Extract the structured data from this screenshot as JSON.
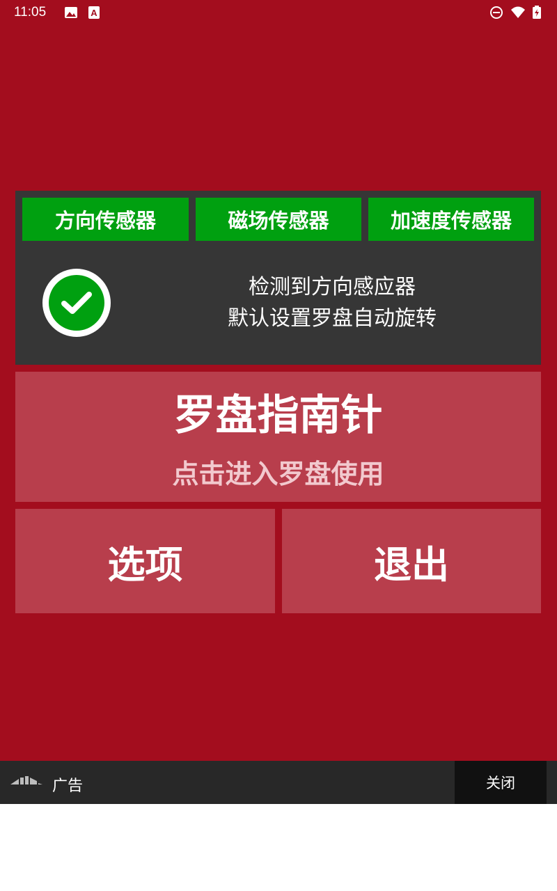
{
  "status_bar": {
    "time": "11:05",
    "left_icons": [
      "image-icon",
      "a-text-icon"
    ],
    "right_icons": [
      "do-not-disturb-icon",
      "wifi-icon",
      "battery-icon"
    ]
  },
  "colors": {
    "background": "#a30d1e",
    "panel": "#363636",
    "sensor_tab": "#00a010",
    "button": "#b83e4c",
    "ad_bar": "#282828"
  },
  "sensors": {
    "tabs": [
      {
        "label": "方向传感器"
      },
      {
        "label": "磁场传感器"
      },
      {
        "label": "加速度传感器"
      }
    ],
    "status_icon": "check-circle-icon",
    "status_line1": "检测到方向感应器",
    "status_line2": "默认设置罗盘自动旋转"
  },
  "main": {
    "compass_title": "罗盘指南针",
    "compass_subtitle": "点击进入罗盘使用",
    "options_label": "选项",
    "exit_label": "退出"
  },
  "ad": {
    "logo_icon": "ad-logo-icon",
    "label": "广告",
    "close_label": "关闭"
  }
}
